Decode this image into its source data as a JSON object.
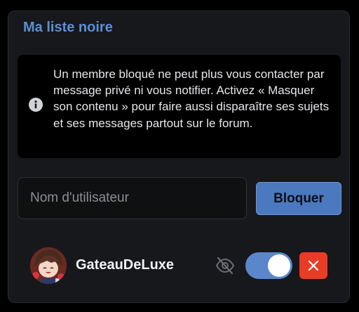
{
  "panel": {
    "title": "Ma liste noire"
  },
  "info": {
    "icon": "info-icon",
    "text": "Un membre bloqué ne peut plus vous contacter par message privé ni vous notifier. Activez « Masquer son contenu » pour faire aussi disparaître ses sujets et ses messages partout sur le forum."
  },
  "block_form": {
    "input_placeholder": "Nom d'utilisateur",
    "input_value": "",
    "button_label": "Bloquer"
  },
  "blocked_users": [
    {
      "username": "GateauDeLuxe",
      "hide_icon": "eye-off-icon",
      "hide_content_enabled": true,
      "remove_icon": "close-icon"
    }
  ],
  "colors": {
    "accent": "#5b8fd6",
    "button": "#4a79bf",
    "toggle_on": "#5a87cb",
    "danger": "#ea3b26",
    "panel_bg": "#17181b"
  }
}
